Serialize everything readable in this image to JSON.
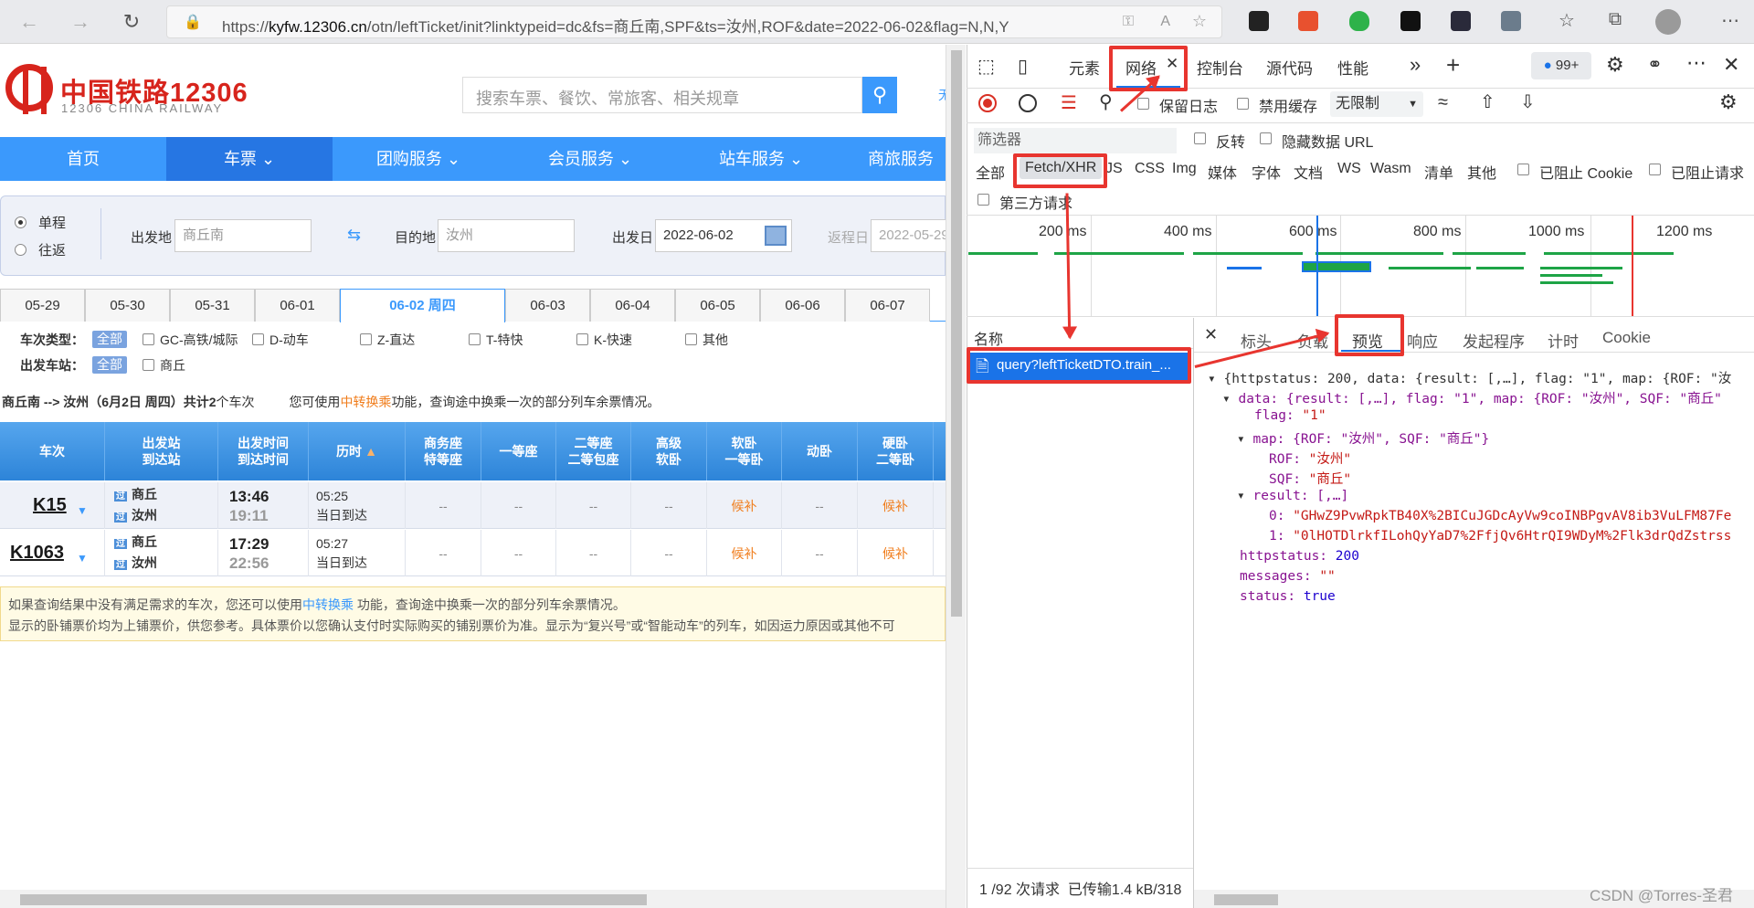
{
  "browser": {
    "url_prefix": "https://",
    "url_host": "kyfw.12306.cn",
    "url_path": "/otn/leftTicket/init?linktypeid=dc&fs=商丘南,SPF&ts=汝州,ROF&date=2022-06-02&flag=N,N,Y"
  },
  "site": {
    "brand_cn": "中国铁路12306",
    "brand_en": "12306 CHINA RAILWAY",
    "search_placeholder": "搜索车票、餐饮、常旅客、相关规章",
    "nav": [
      "首页",
      "车票",
      "团购服务",
      "会员服务",
      "站车服务",
      "商旅服务"
    ]
  },
  "form": {
    "oneway": "单程",
    "roundtrip": "往返",
    "from_label": "出发地",
    "from_value": "商丘南",
    "to_label": "目的地",
    "to_value": "汝州",
    "date_label": "出发日",
    "date_value": "2022-06-02",
    "return_label": "返程日",
    "return_value": "2022-05-29"
  },
  "dates": [
    "05-29",
    "05-30",
    "05-31",
    "06-01",
    "06-02 周四",
    "06-03",
    "06-04",
    "06-05",
    "06-06",
    "06-07"
  ],
  "filters": {
    "type_label": "车次类型：",
    "all": "全部",
    "types": [
      "GC-高铁/城际",
      "D-动车",
      "Z-直达",
      "T-特快",
      "K-快速",
      "其他"
    ],
    "station_label": "出发车站：",
    "stations": [
      "商丘"
    ]
  },
  "summary": {
    "route": "商丘南 --> 汝州（6月2日  周四）共计",
    "count": "2",
    "suffix": "个车次",
    "hint_pre": "您可使用",
    "hint_link": "中转换乘",
    "hint_post": "功能，查询途中换乘一次的部分列车余票情况。"
  },
  "table": {
    "headers": [
      "车次",
      "出发站\n到达站",
      "出发时间\n到达时间",
      "历时",
      "商务座\n特等座",
      "一等座",
      "二等座\n二等包座",
      "高级\n软卧",
      "软卧\n一等卧",
      "动卧",
      "硬卧\n二等卧"
    ],
    "rows": [
      {
        "train": "K15",
        "from": "商丘",
        "to": "汝州",
        "dep": "13:46",
        "arr": "19:11",
        "dur": "05:25",
        "arrive_note": "当日到达",
        "cells": [
          "--",
          "--",
          "--",
          "--",
          "候补",
          "--",
          "候补"
        ]
      },
      {
        "train": "K1063",
        "from": "商丘",
        "to": "汝州",
        "dep": "17:29",
        "arr": "22:56",
        "dur": "05:27",
        "arrive_note": "当日到达",
        "cells": [
          "--",
          "--",
          "--",
          "--",
          "候补",
          "--",
          "候补"
        ]
      }
    ],
    "pass_badge": "过"
  },
  "notice": {
    "line1_pre": "如果查询结果中没有满足需求的车次，您还可以使用",
    "line1_link": "中转换乘",
    "line1_post": " 功能，查询途中换乘一次的部分列车余票情况。",
    "line2": "显示的卧铺票价均为上铺票价，供您参考。具体票价以您确认支付时实际购买的铺别票价为准。显示为“复兴号”或“智能动车”的列车，如因运力原因或其他不可"
  },
  "devtools": {
    "tabs": [
      "元素",
      "网络",
      "控制台",
      "源代码",
      "性能"
    ],
    "badge": "99+",
    "preserve_log": "保留日志",
    "disable_cache": "禁用缓存",
    "throttle": "无限制",
    "filter_placeholder": "筛选器",
    "invert": "反转",
    "hide_data": "隐藏数据 URL",
    "types": [
      "全部",
      "Fetch/XHR",
      "JS",
      "CSS",
      "Img",
      "媒体",
      "字体",
      "文档",
      "WS",
      "Wasm",
      "清单",
      "其他"
    ],
    "blocked_cookie": "已阻止 Cookie",
    "blocked_req": "已阻止请求",
    "third_party": "第三方请求",
    "timeline": [
      "200 ms",
      "400 ms",
      "600 ms",
      "800 ms",
      "1000 ms",
      "1200 ms"
    ],
    "name_header": "名称",
    "request": "query?leftTicketDTO.train_...",
    "detail_tabs": [
      "标头",
      "负载",
      "预览",
      "响应",
      "发起程序",
      "计时",
      "Cookie"
    ],
    "status_bar": "1 /92 次请求  已传输1.4 kB/318",
    "json": {
      "l1": "{httpstatus: 200, data: {result: [,…], flag: \"1\", map: {ROF: \"汝",
      "l2": "data: {result: [,…], flag: \"1\", map: {ROF: \"汝州\", SQF: \"商丘\"",
      "flag_k": "flag:",
      "flag_v": "\"1\"",
      "map": "map: {ROF: \"汝州\", SQF: \"商丘\"}",
      "rof_k": "ROF:",
      "rof_v": "\"汝州\"",
      "sqf_k": "SQF:",
      "sqf_v": "\"商丘\"",
      "result": "result: [,…]",
      "r0_k": "0:",
      "r0_v": "\"GHwZ9PvwRpkTB40X%2BICuJGDcAyVw9coINBPgvAV8ib3VuLFM87Fe",
      "r1_k": "1:",
      "r1_v": "\"0lHOTDlrkfILohQyYaD7%2FfjQv6HtrQI9WDyM%2Flk3drQdZstrss",
      "hs_k": "httpstatus:",
      "hs_v": "200",
      "msg_k": "messages:",
      "msg_v": "\"\"",
      "st_k": "status:",
      "st_v": "true"
    }
  },
  "watermark": "CSDN @Torres-圣君"
}
